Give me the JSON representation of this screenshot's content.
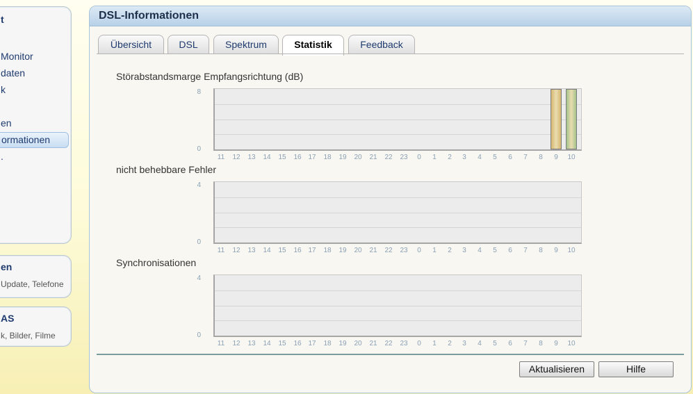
{
  "sidebar": {
    "title": "t",
    "items": [
      {
        "label": "Monitor",
        "active": false
      },
      {
        "label": "daten",
        "active": false
      },
      {
        "label": "k",
        "active": false
      },
      {
        "label": "en",
        "active": false
      },
      {
        "label": "ormationen",
        "active": true
      },
      {
        "label": ".",
        "active": false
      }
    ],
    "boxes": [
      {
        "title": "en",
        "subtitle": "Update, Telefone"
      },
      {
        "title": "AS",
        "subtitle": "k, Bilder, Filme"
      }
    ]
  },
  "panel": {
    "title": "DSL-Informationen",
    "tabs": [
      {
        "label": "Übersicht",
        "active": false
      },
      {
        "label": "DSL",
        "active": false
      },
      {
        "label": "Spektrum",
        "active": false
      },
      {
        "label": "Statistik",
        "active": true
      },
      {
        "label": "Feedback",
        "active": false
      }
    ]
  },
  "charts": [
    {
      "title": "Störabstandsmarge Empfangsrichtung (dB)",
      "ymax": "8",
      "ymin": "0",
      "xlabels": [
        "11",
        "12",
        "13",
        "14",
        "15",
        "16",
        "17",
        "18",
        "19",
        "20",
        "21",
        "22",
        "23",
        "0",
        "1",
        "2",
        "3",
        "4",
        "5",
        "6",
        "7",
        "8",
        "9",
        "10"
      ],
      "values": [
        null,
        null,
        null,
        null,
        null,
        null,
        null,
        null,
        null,
        null,
        null,
        null,
        null,
        null,
        null,
        null,
        null,
        null,
        null,
        null,
        null,
        null,
        8,
        8
      ],
      "colors": [
        "#d7b870",
        "#a3c48b"
      ]
    },
    {
      "title": "nicht behebbare Fehler",
      "ymax": "4",
      "ymin": "0",
      "xlabels": [
        "11",
        "12",
        "13",
        "14",
        "15",
        "16",
        "17",
        "18",
        "19",
        "20",
        "21",
        "22",
        "23",
        "0",
        "1",
        "2",
        "3",
        "4",
        "5",
        "6",
        "7",
        "8",
        "9",
        "10"
      ],
      "values": []
    },
    {
      "title": "Synchronisationen",
      "ymax": "4",
      "ymin": "0",
      "xlabels": [
        "11",
        "12",
        "13",
        "14",
        "15",
        "16",
        "17",
        "18",
        "19",
        "20",
        "21",
        "22",
        "23",
        "0",
        "1",
        "2",
        "3",
        "4",
        "5",
        "6",
        "7",
        "8",
        "9",
        "10"
      ],
      "values": []
    }
  ],
  "buttons": {
    "refresh": "Aktualisieren",
    "help": "Hilfe"
  }
}
